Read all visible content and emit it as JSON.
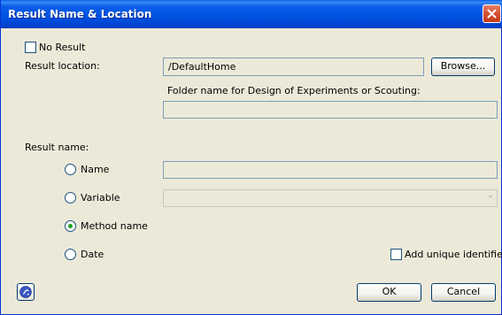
{
  "window": {
    "title": "Result Name & Location"
  },
  "no_result": {
    "label": "No Result",
    "checked": false
  },
  "result_location": {
    "label": "Result location:",
    "value": "/DefaultHome",
    "browse_label": "Browse..."
  },
  "folder_name": {
    "label": "Folder name for Design of Experiments or Scouting:",
    "value": ""
  },
  "result_name": {
    "label": "Result name:",
    "options": [
      {
        "label": "Name",
        "selected": false
      },
      {
        "label": "Variable",
        "selected": false
      },
      {
        "label": "Method name",
        "selected": true
      },
      {
        "label": "Date",
        "selected": false
      }
    ],
    "name_value": "",
    "variable_value": ""
  },
  "add_unique_identifier": {
    "label": "Add unique identifier",
    "checked": false
  },
  "footer": {
    "ok_label": "OK",
    "cancel_label": "Cancel"
  },
  "colors": {
    "titlebar": "#0054e3",
    "dialog_bg": "#ece9d8",
    "radio_dot": "#21a121",
    "close_button": "#d85335"
  }
}
